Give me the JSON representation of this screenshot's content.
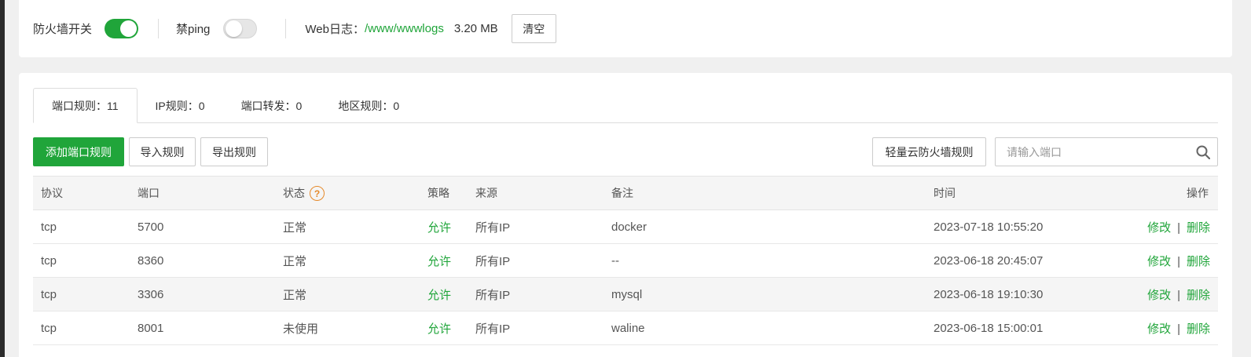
{
  "topbar": {
    "firewall_label": "防火墙开关",
    "firewall_on": true,
    "ping_label": "禁ping",
    "ping_on": false,
    "weblog_label": "Web日志：",
    "weblog_path": "/www/wwwlogs",
    "weblog_size": "3.20 MB",
    "clear_label": "清空"
  },
  "tabs": [
    {
      "label": "端口规则：11",
      "active": true
    },
    {
      "label": "IP规则：0",
      "active": false
    },
    {
      "label": "端口转发：0",
      "active": false
    },
    {
      "label": "地区规则：0",
      "active": false
    }
  ],
  "toolbar": {
    "add_label": "添加端口规则",
    "import_label": "导入规则",
    "export_label": "导出规则",
    "cloud_label": "轻量云防火墙规则",
    "search_placeholder": "请输入端口"
  },
  "table": {
    "headers": {
      "protocol": "协议",
      "port": "端口",
      "status": "状态",
      "status_help": "?",
      "policy": "策略",
      "source": "来源",
      "note": "备注",
      "time": "时间",
      "ops": "操作"
    },
    "rows": [
      {
        "protocol": "tcp",
        "port": "5700",
        "status": "正常",
        "policy": "允许",
        "source": "所有IP",
        "note": "docker",
        "time": "2023-07-18 10:55:20",
        "edit": "修改",
        "sep": "|",
        "delete": "删除"
      },
      {
        "protocol": "tcp",
        "port": "8360",
        "status": "正常",
        "policy": "允许",
        "source": "所有IP",
        "note": "--",
        "time": "2023-06-18 20:45:07",
        "edit": "修改",
        "sep": "|",
        "delete": "删除"
      },
      {
        "protocol": "tcp",
        "port": "3306",
        "status": "正常",
        "policy": "允许",
        "source": "所有IP",
        "note": "mysql",
        "time": "2023-06-18 19:10:30",
        "edit": "修改",
        "sep": "|",
        "delete": "删除"
      },
      {
        "protocol": "tcp",
        "port": "8001",
        "status": "未使用",
        "policy": "允许",
        "source": "所有IP",
        "note": "waline",
        "time": "2023-06-18 15:00:01",
        "edit": "修改",
        "sep": "|",
        "delete": "删除"
      }
    ]
  },
  "colors": {
    "accent": "#20a53a",
    "help_icon": "#e5892a"
  }
}
